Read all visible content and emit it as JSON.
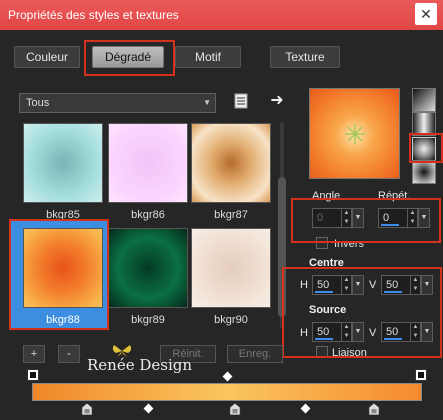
{
  "window": {
    "title": "Propriétés des styles et textures",
    "close_glyph": "✕"
  },
  "tabs": [
    {
      "label": "Couleur",
      "active": false
    },
    {
      "label": "Dégradé",
      "active": true
    },
    {
      "label": "Motif",
      "active": false
    },
    {
      "label": "Texture",
      "active": false
    }
  ],
  "library": {
    "category_select": "Tous",
    "icons": [
      "document-icon",
      "arrow-right-icon"
    ],
    "thumbnails": [
      {
        "label": "bkgr85",
        "colors": [
          "#a5dede",
          "#7ab3b5"
        ]
      },
      {
        "label": "bkgr86",
        "colors": [
          "#fbd6ff",
          "#f2c4f7"
        ]
      },
      {
        "label": "bkgr87",
        "colors": [
          "#f7e3c7",
          "#b56a2b"
        ]
      },
      {
        "label": "bkgr88",
        "colors": [
          "#e9531a",
          "#f9b44c"
        ],
        "selected": true
      },
      {
        "label": "bkgr89",
        "colors": [
          "#043a22",
          "#0b6f45"
        ]
      },
      {
        "label": "bkgr90",
        "colors": [
          "#f7efe6",
          "#e4cdbd"
        ]
      }
    ]
  },
  "gradient": {
    "angle_label": "Angle",
    "angle_value": "0",
    "repeat_label": "Répét.",
    "repeat_value": "0",
    "invert_label": "Invers",
    "invert_checked": false,
    "center_label": "Centre",
    "center_h_label": "H",
    "center_h": "50",
    "center_v_label": "V",
    "center_v": "50",
    "source_label": "Source",
    "source_h_label": "H",
    "source_h": "50",
    "source_v_label": "V",
    "source_v": "50",
    "link_label": "Liaison",
    "link_checked": false,
    "colors": {
      "start": "#f0882a",
      "middle": "#fbc65f",
      "end": "#f58a2f"
    }
  },
  "buttons": {
    "add": "+",
    "remove": "-",
    "reset": "Réinit.",
    "save": "Enreg."
  },
  "watermark": "Renée Design",
  "accent": "#d4321e",
  "selection_color": "#3b8ee0"
}
